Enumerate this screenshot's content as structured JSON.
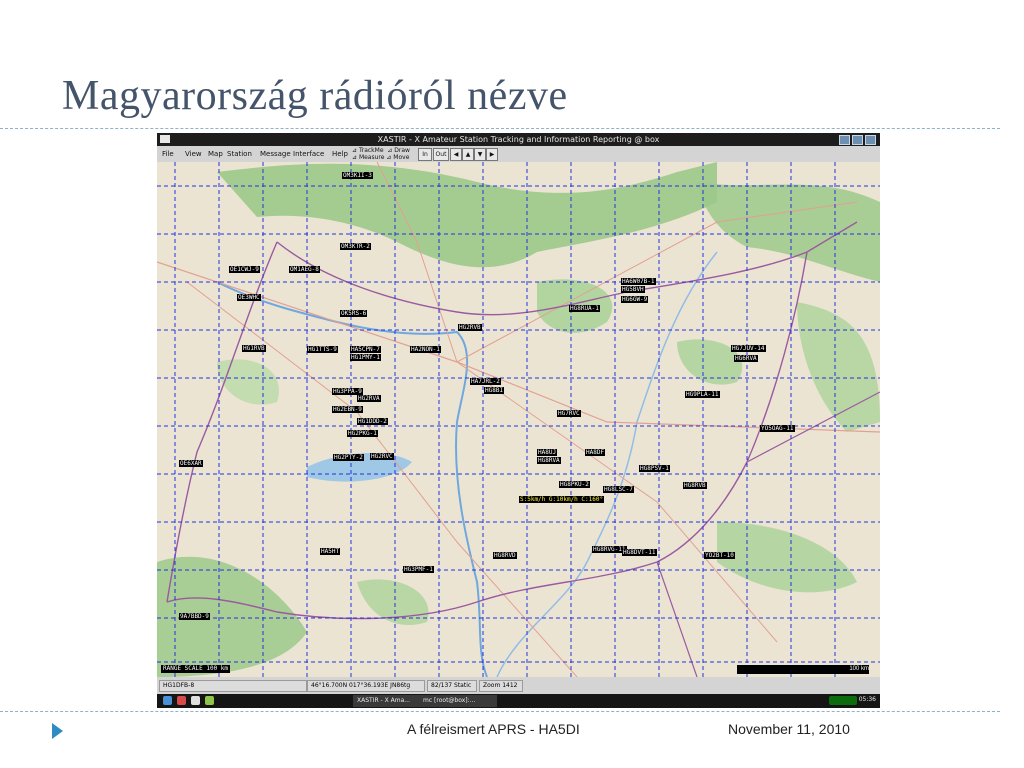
{
  "slide": {
    "title": "Magyarország rádióról nézve",
    "footer_center": "A félreismert APRS - HA5DI",
    "footer_date": "November 11, 2010"
  },
  "window": {
    "title": "XASTIR - X Amateur Station Tracking and Information Reporting @ box"
  },
  "menu": {
    "items": [
      "File",
      "View",
      "Map",
      "Station",
      "Message",
      "Interface",
      "Help"
    ],
    "tools": {
      "trackme": "TrackMe",
      "draw": "Draw",
      "measure": "Measure",
      "move": "Move"
    },
    "zoom_in": "In",
    "zoom_out": "Out",
    "pan_left": "◀",
    "pan_up": "▲",
    "pan_down": "▼",
    "pan_right": "▶"
  },
  "map": {
    "scale_label": "RANGE SCALE 100 km",
    "scalebar_label": "100 km",
    "stations": [
      {
        "label": "OM3KII-3",
        "style": "white"
      },
      {
        "label": "OM3KTR-2",
        "style": "white"
      },
      {
        "label": "OE1CWJ-9",
        "style": "white"
      },
      {
        "label": "OM1AEG-8",
        "style": "white"
      },
      {
        "label": "OE3WHC",
        "style": "white"
      },
      {
        "label": "OK5RS-6",
        "style": "white"
      },
      {
        "label": "HA6W07B-1",
        "style": "white"
      },
      {
        "label": "HG5BVH",
        "style": "white"
      },
      {
        "label": "HG6GW-9",
        "style": "white"
      },
      {
        "label": "HG8RUA-1",
        "style": "white"
      },
      {
        "label": "HG1RVB",
        "style": "white"
      },
      {
        "label": "HG1TTS-9",
        "style": "white"
      },
      {
        "label": "HA5CPN-7",
        "style": "white"
      },
      {
        "label": "HG1PMY-1",
        "style": "white"
      },
      {
        "label": "HA2NON-1",
        "style": "white"
      },
      {
        "label": "HG2RVB",
        "style": "white"
      },
      {
        "label": "HG7JUV-14",
        "style": "white"
      },
      {
        "label": "HG6RVA",
        "style": "white"
      },
      {
        "label": "HG3PPA-9",
        "style": "white"
      },
      {
        "label": "HG2RVA",
        "style": "white"
      },
      {
        "label": "HG2EBN-9",
        "style": "white"
      },
      {
        "label": "HG1DDD-2",
        "style": "white"
      },
      {
        "label": "HG2PKG-1",
        "style": "white"
      },
      {
        "label": "HG7RVC",
        "style": "white"
      },
      {
        "label": "HG9PLA-11",
        "style": "white"
      },
      {
        "label": "YO5OAG-11",
        "style": "white"
      },
      {
        "label": "OE6XAR",
        "style": "white"
      },
      {
        "label": "HG2PTY-2",
        "style": "white"
      },
      {
        "label": "HG2RVC",
        "style": "white"
      },
      {
        "label": "HA8UJ",
        "style": "white"
      },
      {
        "label": "HG8RVA",
        "style": "white"
      },
      {
        "label": "HA8DF",
        "style": "white"
      },
      {
        "label": "HG8PSV-1",
        "style": "white"
      },
      {
        "label": "HG8RVB",
        "style": "white"
      },
      {
        "label": "HG8PKU-2",
        "style": "white"
      },
      {
        "label": "HG8LSC-7",
        "style": "white"
      },
      {
        "label": "S:5km/h G:10km/h C:160°",
        "style": "yellow"
      },
      {
        "label": "HA5HT",
        "style": "white"
      },
      {
        "label": "HG8RVD",
        "style": "white"
      },
      {
        "label": "HG8RVG-11",
        "style": "white"
      },
      {
        "label": "HG8DVT-11",
        "style": "white"
      },
      {
        "label": "YO2BT-10",
        "style": "white"
      },
      {
        "label": "HG3PMF-1",
        "style": "white"
      },
      {
        "label": "9A7BBD-9",
        "style": "white"
      },
      {
        "label": "HG8BI",
        "style": "white"
      },
      {
        "label": "HA7JRL-2",
        "style": "white"
      }
    ]
  },
  "status": {
    "callsign": "HG1DFB-8",
    "coords": "46°16.700N  017°36.193E  JN86tg",
    "count": "82/137 Static",
    "zoom": "Zoom 1412"
  },
  "taskbar": {
    "task1": "XASTIR - X Ama...",
    "task2": "mc [root@box]:...",
    "clock": "05:36"
  }
}
